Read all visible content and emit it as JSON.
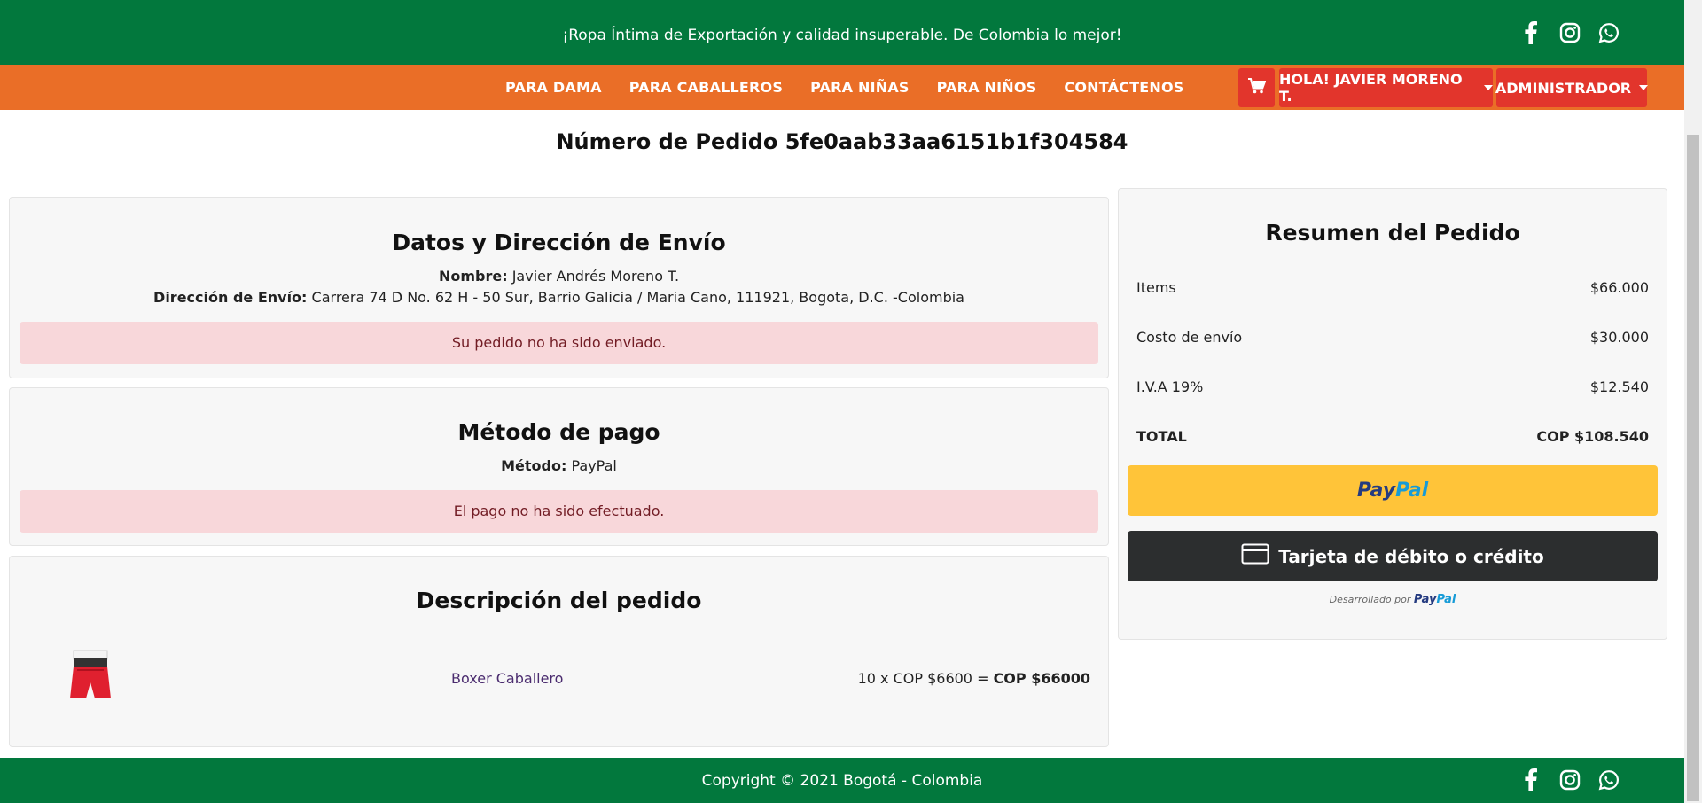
{
  "topbar": {
    "promo": "¡Ropa Íntima de Exportación y calidad insuperable. De Colombia lo mejor!"
  },
  "nav": {
    "links": [
      "PARA DAMA",
      "PARA CABALLEROS",
      "PARA NIÑAS",
      "PARA NIÑOS",
      "CONTÁCTENOS"
    ],
    "user_label": "HOLA! JAVIER MORENO T.",
    "admin_label": "ADMINISTRADOR"
  },
  "order": {
    "title": "Número de Pedido 5fe0aab33aa6151b1f304584"
  },
  "shipping": {
    "heading": "Datos y Dirección de Envío",
    "name_label": "Nombre:",
    "name_value": " Javier Andrés Moreno T.",
    "address_label": "Dirección de Envío:",
    "address_value": " Carrera 74 D No. 62 H - 50 Sur, Barrio Galicia / Maria Cano, 111921, Bogota, D.C. -Colombia",
    "status": "Su pedido no ha sido enviado."
  },
  "payment": {
    "heading": "Método de pago",
    "method_label": "Método:",
    "method_value": " PayPal",
    "status": "El pago no ha sido efectuado."
  },
  "description": {
    "heading": "Descripción del pedido",
    "items": [
      {
        "name": "Boxer Caballero",
        "qty_price": "10 x COP $6600 = ",
        "total": "COP $66000"
      }
    ]
  },
  "summary": {
    "heading": "Resumen del Pedido",
    "rows": [
      {
        "label": "Items",
        "value": "$66.000"
      },
      {
        "label": "Costo de envío",
        "value": "$30.000"
      },
      {
        "label": "I.V.A 19%",
        "value": "$12.540"
      },
      {
        "label": "TOTAL",
        "value": "COP $108.540"
      }
    ],
    "paypal_part1": "Pay",
    "paypal_part2": "Pal",
    "card_button": "Tarjeta de débito o crédito",
    "powered_text": "Desarrollado por ",
    "powered_brand1": "Pay",
    "powered_brand2": "Pal"
  },
  "footer": {
    "copyright": "Copyright © 2021 Bogotá - Colombia"
  },
  "colors": {
    "green": "#02783d",
    "orange": "#ea6e27",
    "red": "#e2352c",
    "paypal_yellow": "#ffc439"
  }
}
